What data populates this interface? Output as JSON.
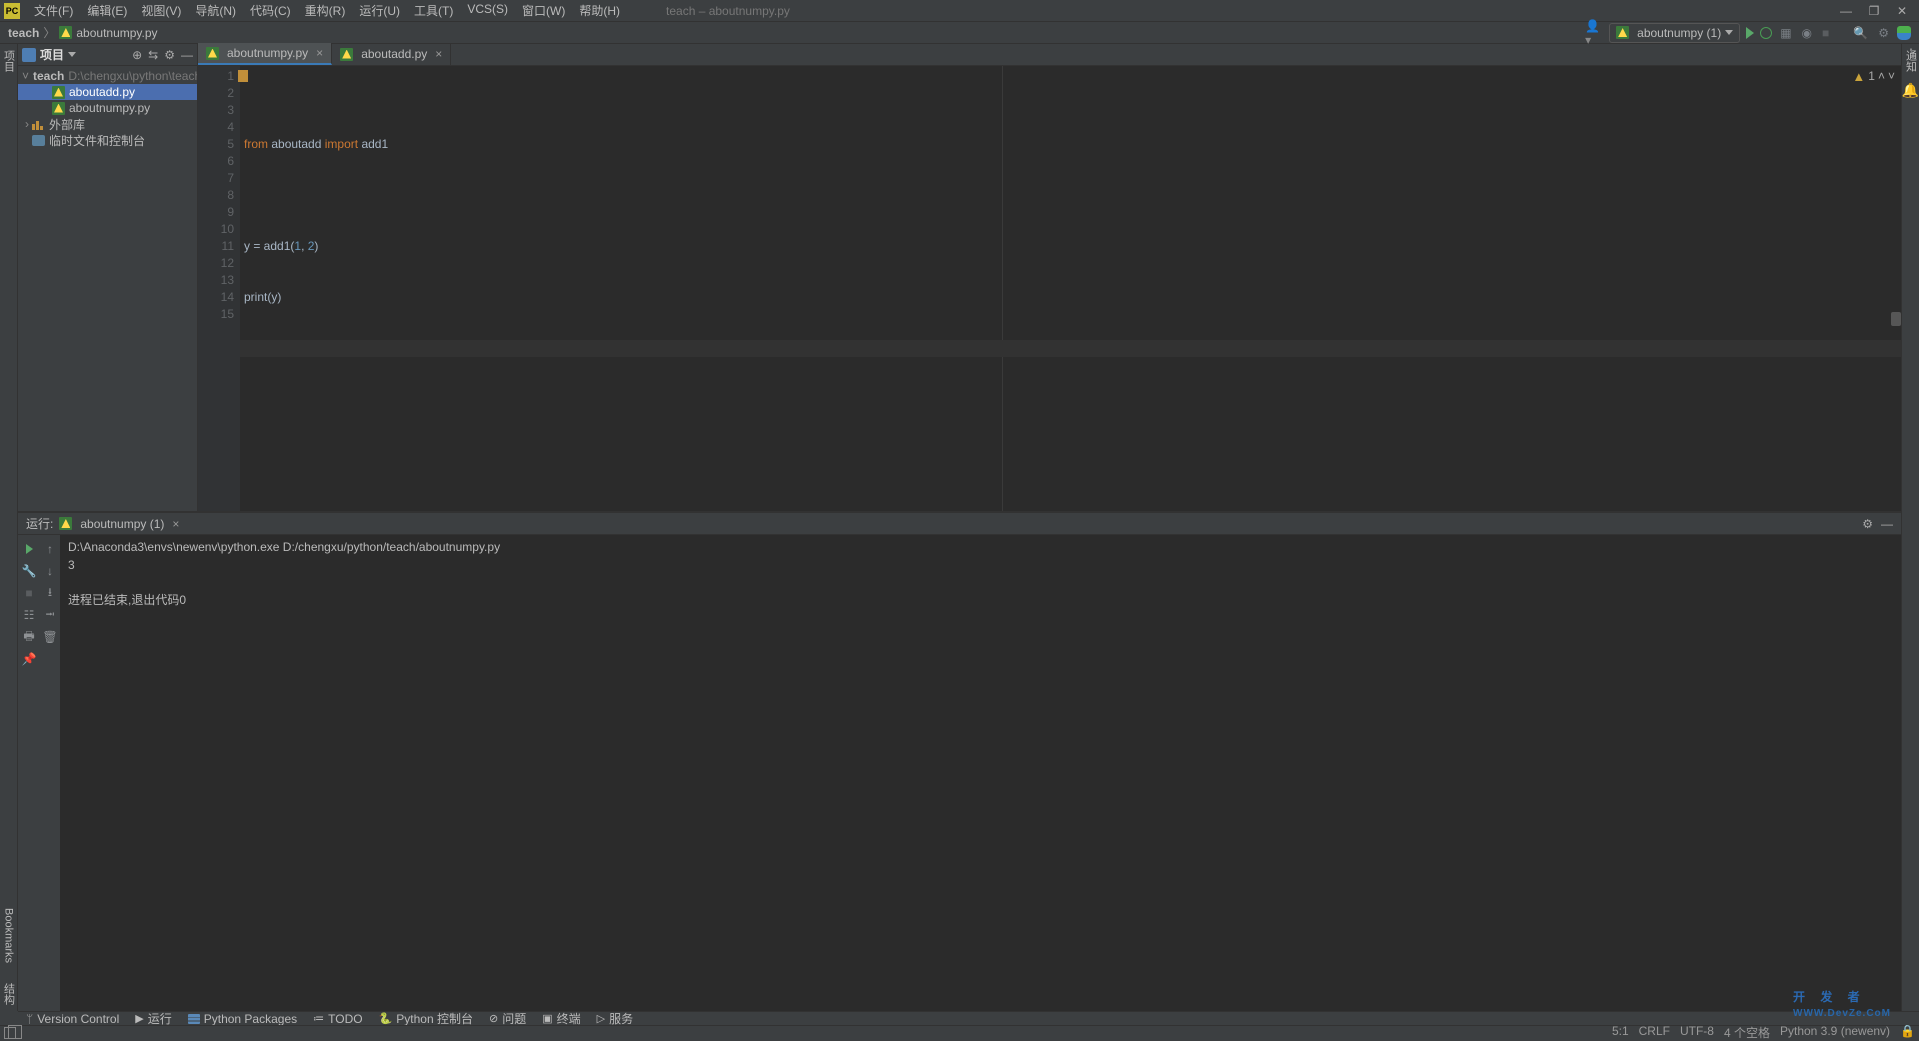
{
  "window": {
    "title": "teach – aboutnumpy.py"
  },
  "menu": [
    "文件(F)",
    "编辑(E)",
    "视图(V)",
    "导航(N)",
    "代码(C)",
    "重构(R)",
    "运行(U)",
    "工具(T)",
    "VCS(S)",
    "窗口(W)",
    "帮助(H)"
  ],
  "breadcrumbs": {
    "root": "teach",
    "file": "aboutnumpy.py"
  },
  "run_config": {
    "label": "aboutnumpy (1)"
  },
  "left_tabs": {
    "project": "项目",
    "bookmarks": "Bookmarks",
    "structure": "结构"
  },
  "right_tabs": {
    "notifications": "通知"
  },
  "project_panel": {
    "title": "项目",
    "root": {
      "name": "teach",
      "path": "D:\\chengxu\\python\\teach"
    },
    "files": [
      {
        "name": "aboutadd.py",
        "selected": true
      },
      {
        "name": "aboutnumpy.py",
        "selected": false
      }
    ],
    "libs": "外部库",
    "scratch": "临时文件和控制台"
  },
  "editor_tabs": [
    {
      "name": "aboutnumpy.py",
      "active": true
    },
    {
      "name": "aboutadd.py",
      "active": false
    }
  ],
  "editor": {
    "problems_count": "1",
    "lines": [
      "1",
      "2",
      "3",
      "4",
      "5",
      "6",
      "7",
      "8",
      "9",
      "10",
      "11",
      "12",
      "13",
      "14",
      "15"
    ],
    "code": {
      "l1_from": "from",
      "l1_mod": "aboutadd",
      "l1_import": "import",
      "l1_name": "add1",
      "l3_a": "y = add1(",
      "l3_n1": "1",
      "l3_c": ", ",
      "l3_n2": "2",
      "l3_z": ")",
      "l4_a": "print(y)"
    },
    "caret": {
      "line": 5,
      "col": 1
    }
  },
  "run_panel": {
    "label": "运行:",
    "config": "aboutnumpy (1)",
    "output": {
      "cmd": "D:\\Anaconda3\\envs\\newenv\\python.exe D:/chengxu/python/teach/aboutnumpy.py",
      "result": "3",
      "exit": "进程已结束,退出代码0"
    }
  },
  "bottom_tools": {
    "vc": "Version Control",
    "run": "运行",
    "pkg": "Python Packages",
    "todo": "TODO",
    "pycon": "Python 控制台",
    "prob": "问题",
    "term": "终端",
    "svc": "服务"
  },
  "status": {
    "pos": "5:1",
    "eol": "CRLF",
    "enc": "UTF-8",
    "indent": "4 个空格",
    "interp": "Python 3.9 (newenv)"
  },
  "watermark": {
    "text": "开 发 者",
    "url": "WWW.DevZe.CoM"
  }
}
